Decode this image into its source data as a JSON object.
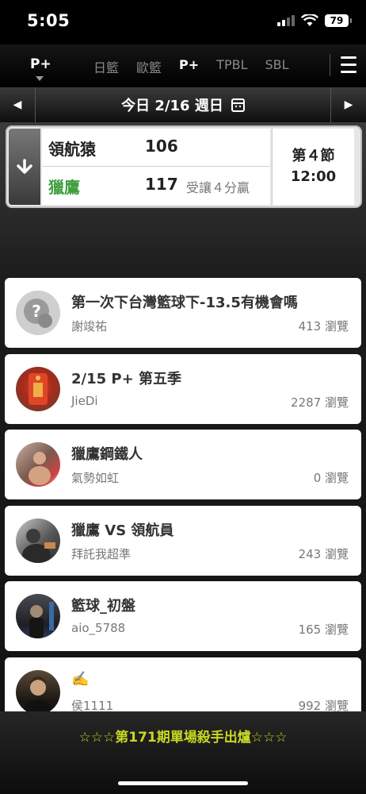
{
  "status_bar": {
    "time": "5:05",
    "battery": "79"
  },
  "league_bar": {
    "current": "P+",
    "tabs": [
      "日籃",
      "歐籃",
      "P+",
      "TPBL",
      "SBL"
    ],
    "active_tab": "P+"
  },
  "date_bar": {
    "date": "今日 2/16 週日"
  },
  "game": {
    "team1": {
      "name": "領航猿",
      "score": "106"
    },
    "team2": {
      "name": "獵鷹",
      "score": "117"
    },
    "spread": "受讓４分贏",
    "period": "第４節",
    "clock": "12:00"
  },
  "posts": [
    {
      "title": "第一次下台灣籃球下-13.5有機會嗎",
      "author": "謝竣祐",
      "views": "413 瀏覽",
      "avatar": "question-avatar"
    },
    {
      "title": "2/15 P+ 第五季",
      "author": "JieDi",
      "views": "2287 瀏覽",
      "avatar": "red-envelope-avatar"
    },
    {
      "title": "獵鷹鋼鐵人",
      "author": "氣勢如虹",
      "views": "0 瀏覽",
      "avatar": "photo-avatar"
    },
    {
      "title": "獵鷹 VS 領航員",
      "author": "拜託我超準",
      "views": "243 瀏覽",
      "avatar": "photo-avatar"
    },
    {
      "title": "籃球_初盤",
      "author": "aio_5788",
      "views": "165 瀏覽",
      "avatar": "photo-avatar"
    },
    {
      "title": "✍️",
      "author": "侯1111",
      "views": "992 瀏覽",
      "avatar": "photo-avatar"
    }
  ],
  "banner": "☆☆☆第171期單場殺手出爐☆☆☆",
  "colors": {
    "accent_green": "#3f9f3f",
    "banner_yellow": "#c7d821"
  }
}
